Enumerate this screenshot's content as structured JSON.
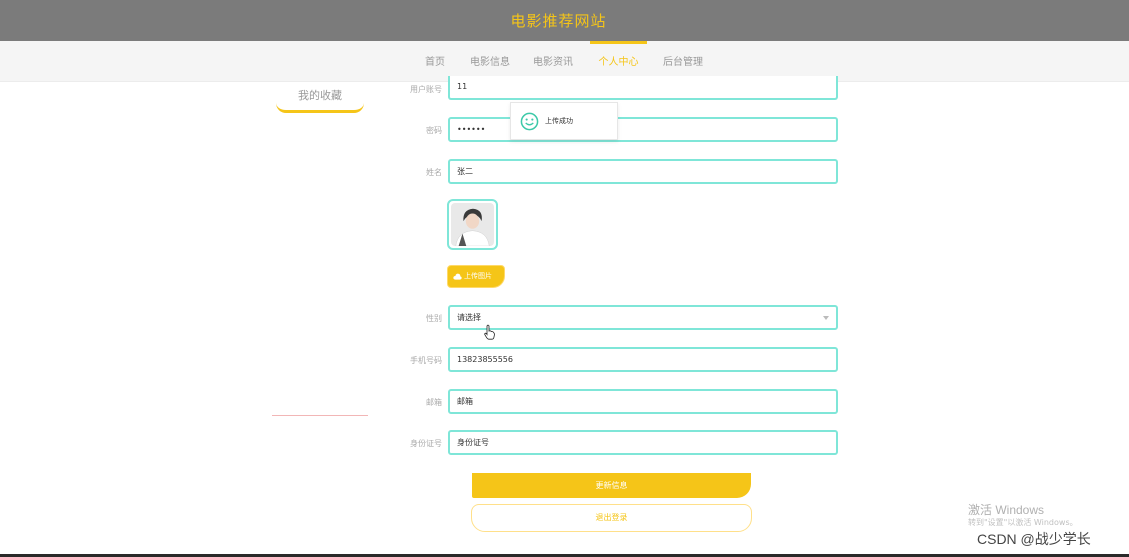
{
  "header": {
    "site_title": "电影推荐网站"
  },
  "nav": {
    "items": [
      {
        "label": "首页",
        "active": false
      },
      {
        "label": "电影信息",
        "active": false
      },
      {
        "label": "电影资讯",
        "active": false
      },
      {
        "label": "个人中心",
        "active": true
      },
      {
        "label": "后台管理",
        "active": false
      }
    ]
  },
  "sidebar": {
    "favorites_label": "我的收藏"
  },
  "form": {
    "username": {
      "label": "用户账号",
      "value": "11"
    },
    "password": {
      "label": "密码",
      "value": "••••••"
    },
    "name": {
      "label": "姓名",
      "value": "张二"
    },
    "upload_label": "上传图片",
    "gender": {
      "label": "性别",
      "value": "请选择"
    },
    "phone": {
      "label": "手机号码",
      "value": "13823855556"
    },
    "email": {
      "label": "邮箱",
      "value": "邮箱"
    },
    "id_card": {
      "label": "身份证号",
      "value": "身份证号"
    }
  },
  "toast": {
    "message": "上传成功",
    "icon": "smile-icon"
  },
  "actions": {
    "update_label": "更新信息",
    "logout_label": "退出登录"
  },
  "overlay": {
    "activate_title": "激活 Windows",
    "activate_sub": "转到\"设置\"以激活 Windows。",
    "watermark": "CSDN @战少学长"
  },
  "colors": {
    "accent": "#f5c518",
    "field_border": "#7fe6d8",
    "topbar": "#7b7b7b"
  }
}
